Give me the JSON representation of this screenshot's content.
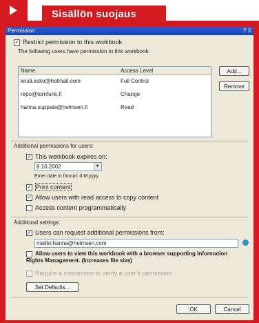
{
  "banner": {
    "title": "Sisällön suojaus"
  },
  "dialog": {
    "title": "Permission",
    "title_buttons": "? X",
    "restrict_label": "Restrict permission to this workbook",
    "users_caption": "The following users have permission to this workbook:",
    "col_name": "Name",
    "col_access": "Access Level",
    "users": [
      {
        "name": "kirsti.esko@hotmail.com",
        "access": "Full Control"
      },
      {
        "name": "repo@tornfunk.fi",
        "access": "Change"
      },
      {
        "name": "hanna.suppala@helmsen.fi",
        "access": "Read"
      }
    ],
    "add_label": "Add...",
    "remove_label": "Remove",
    "additional_perm_label": "Additional permissions for users:",
    "expires_label": "This workbook expires on:",
    "expire_date": "8.10.2002",
    "expire_note": "Enter date in format: d.M.yyyy",
    "print_label": "Print content",
    "copy_label": "Allow users with read access to copy content",
    "programmatic_label": "Access content programmatically",
    "additional_settings_label": "Additional settings:",
    "request_label": "Users can request additional permissions from:",
    "request_email": "mailto:hanna@helmsen.com",
    "view_label": "Allow users to view this workbook with a browser supporting Information Rights Management. (Increases file size)",
    "connect_label": "Require a connection to verify a user's permission",
    "set_defaults_label": "Set Defaults...",
    "ok_label": "OK",
    "cancel_label": "Cancel"
  }
}
